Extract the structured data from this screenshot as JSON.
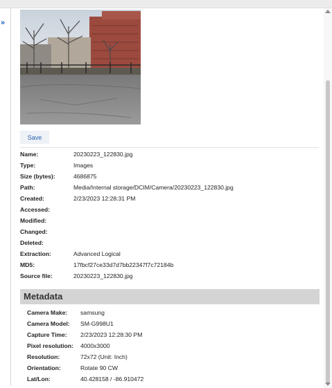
{
  "toolbar": {
    "collapse_icon": "double-chevron-icon"
  },
  "actions": {
    "save_label": "Save"
  },
  "properties": [
    {
      "label": "Name:",
      "value": "20230223_122830.jpg"
    },
    {
      "label": "Type:",
      "value": "Images"
    },
    {
      "label": "Size (bytes):",
      "value": "4686875"
    },
    {
      "label": "Path:",
      "value": "Media/Internal storage/DCIM/Camera/20230223_122830.jpg"
    },
    {
      "label": "Created:",
      "value": "2/23/2023 12:28:31 PM"
    },
    {
      "label": "Accessed:",
      "value": ""
    },
    {
      "label": "Modified:",
      "value": ""
    },
    {
      "label": "Changed:",
      "value": ""
    },
    {
      "label": "Deleted:",
      "value": ""
    },
    {
      "label": "Extraction:",
      "value": "Advanced Logical"
    },
    {
      "label": "MD5:",
      "value": "17fbcf27ce33d7d7bb22347f7c72184b"
    },
    {
      "label": "Source file:",
      "value": "20230223_122830.jpg"
    }
  ],
  "metadata": {
    "title": "Metadata",
    "items": [
      {
        "label": "Camera Make:",
        "value": "samsung"
      },
      {
        "label": "Camera Model:",
        "value": "SM-G998U1"
      },
      {
        "label": "Capture Time:",
        "value": "2/23/2023 12:28:30 PM"
      },
      {
        "label": "Pixel resolution:",
        "value": "4000x3000"
      },
      {
        "label": "Resolution:",
        "value": "72x72 (Unit: Inch)"
      },
      {
        "label": "Orientation:",
        "value": "Rotate 90 CW"
      },
      {
        "label": "Lat/Lon:",
        "value": "40.428158 / -86.910472"
      }
    ]
  }
}
